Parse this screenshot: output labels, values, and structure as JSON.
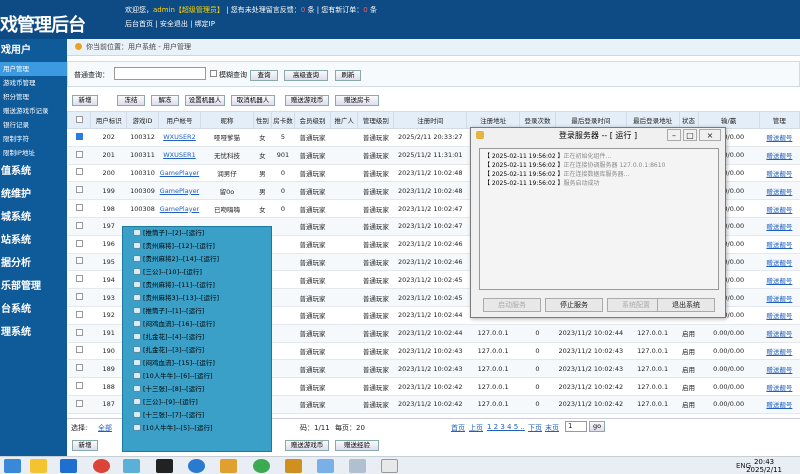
{
  "logo": "戏管理后台",
  "topbar": {
    "welcome": "欢迎您，",
    "admin": "admin【超级管理员】",
    "sep1": "|",
    "unread_label": "您有未处理留言反馈：",
    "unread_count": "0",
    "unit1": "条",
    "sep2": "|",
    "newmsg_label": "您有新订单：",
    "newmsg_count": "0",
    "unit2": "条",
    "links": [
      "后台首页",
      "|",
      "安全退出",
      "|",
      "绑定IP"
    ]
  },
  "sidebar": {
    "items": [
      {
        "text": "戏用户",
        "type": "head"
      },
      {
        "text": "用户管理",
        "type": "item",
        "active": true
      },
      {
        "text": "游戏币管理",
        "type": "item"
      },
      {
        "text": "积分管理",
        "type": "item"
      },
      {
        "text": "赠送游戏币记录",
        "type": "item"
      },
      {
        "text": "银行记录",
        "type": "item"
      },
      {
        "text": "限制字符",
        "type": "item"
      },
      {
        "text": "限制IP地址",
        "type": "item"
      },
      {
        "text": "值系统",
        "type": "head"
      },
      {
        "text": "统维护",
        "type": "head"
      },
      {
        "text": "城系统",
        "type": "head"
      },
      {
        "text": "站系统",
        "type": "head"
      },
      {
        "text": "据分析",
        "type": "head"
      },
      {
        "text": "乐部管理",
        "type": "head"
      },
      {
        "text": "台系统",
        "type": "head"
      },
      {
        "text": "理系统",
        "type": "head"
      }
    ]
  },
  "breadcrumb": "你当前位置：用户系统 - 用户管理",
  "query": {
    "label": "普通查询：",
    "value": "",
    "fuzzy": "模糊查询",
    "search": "查询",
    "advanced": "高级查询",
    "refresh": "刷新"
  },
  "actions": [
    "新增",
    "冻结",
    "解冻",
    "设置机器人",
    "取消机器人",
    "赠送游戏币",
    "赠送房卡"
  ],
  "table": {
    "headers": [
      "",
      "用户标识",
      "游戏ID",
      "用户帐号",
      "昵称",
      "性别",
      "房卡数",
      "会员级别",
      "推广人",
      "管理级别",
      "注册时间",
      "注册地址",
      "登录次数",
      "最后登录时间",
      "最后登录地址",
      "状态",
      "输/赢",
      "管理"
    ],
    "rows": [
      [
        "on",
        "202",
        "100312",
        "WXUSER2",
        "哑哑爹猫",
        "女",
        "5",
        "普通玩家",
        "",
        "普通玩家",
        "2025/2/11 20:33:27",
        "",
        "",
        "",
        "",
        "",
        "0.00/0.00",
        "赠送靓号"
      ],
      [
        "",
        "201",
        "100311",
        "WXUSER1",
        "无忧科技",
        "女",
        "901",
        "普通玩家",
        "",
        "普通玩家",
        "2025/11/2 11:31:01",
        "",
        "",
        "",
        "",
        "",
        "0.00/0.00",
        "赠送靓号"
      ],
      [
        "",
        "200",
        "100310",
        "GamePlayer",
        "润男仔",
        "男",
        "0",
        "普通玩家",
        "",
        "普通玩家",
        "2023/11/2 10:02:48",
        "",
        "",
        "",
        "",
        "",
        "0.00/0.00",
        "赠送靓号"
      ],
      [
        "",
        "199",
        "100309",
        "GamePlayer",
        "留0o",
        "男",
        "0",
        "普通玩家",
        "",
        "普通玩家",
        "2023/11/2 10:02:48",
        "",
        "",
        "",
        "",
        "",
        "0.00/0.00",
        "赠送靓号"
      ],
      [
        "",
        "198",
        "100308",
        "GamePlayer",
        "已吻嗨嗨",
        "女",
        "0",
        "普通玩家",
        "",
        "普通玩家",
        "2023/11/2 10:02:47",
        "",
        "",
        "",
        "",
        "",
        "0.00/0.00",
        "赠送靓号"
      ],
      [
        "",
        "197",
        "",
        "",
        "",
        "",
        "",
        "普通玩家",
        "",
        "普通玩家",
        "2023/11/2 10:02:47",
        "",
        "",
        "",
        "",
        "",
        "0.00/0.00",
        "赠送靓号"
      ],
      [
        "",
        "196",
        "",
        "",
        "",
        "",
        "",
        "普通玩家",
        "",
        "普通玩家",
        "2023/11/2 10:02:46",
        "",
        "",
        "",
        "",
        "",
        "0.00/0.00",
        "赠送靓号"
      ],
      [
        "",
        "195",
        "",
        "",
        "",
        "",
        "",
        "普通玩家",
        "",
        "普通玩家",
        "2023/11/2 10:02:46",
        "",
        "",
        "",
        "",
        "",
        "0.00/0.00",
        "赠送靓号"
      ],
      [
        "",
        "194",
        "",
        "",
        "",
        "",
        "",
        "普通玩家",
        "",
        "普通玩家",
        "2023/11/2 10:02:45",
        "",
        "",
        "",
        "",
        "",
        "0.00/0.00",
        "赠送靓号"
      ],
      [
        "",
        "193",
        "",
        "",
        "",
        "",
        "",
        "普通玩家",
        "",
        "普通玩家",
        "2023/11/2 10:02:45",
        "",
        "",
        "",
        "",
        "",
        "0.00/0.00",
        "赠送靓号"
      ],
      [
        "",
        "192",
        "",
        "",
        "",
        "",
        "",
        "普通玩家",
        "",
        "普通玩家",
        "2023/11/2 10:02:44",
        "",
        "",
        "",
        "",
        "",
        "0.00/0.00",
        "赠送靓号"
      ],
      [
        "",
        "191",
        "",
        "",
        "",
        "",
        "",
        "普通玩家",
        "",
        "普通玩家",
        "2023/11/2 10:02:44",
        "127.0.0.1",
        "0",
        "2023/11/2 10:02:44",
        "127.0.0.1",
        "启用",
        "0.00/0.00",
        "赠送靓号"
      ],
      [
        "",
        "190",
        "",
        "",
        "",
        "",
        "",
        "普通玩家",
        "",
        "普通玩家",
        "2023/11/2 10:02:43",
        "127.0.0.1",
        "0",
        "2023/11/2 10:02:43",
        "127.0.0.1",
        "启用",
        "0.00/0.00",
        "赠送靓号"
      ],
      [
        "",
        "189",
        "",
        "",
        "",
        "",
        "",
        "普通玩家",
        "",
        "普通玩家",
        "2023/11/2 10:02:43",
        "127.0.0.1",
        "0",
        "2023/11/2 10:02:43",
        "127.0.0.1",
        "启用",
        "0.00/0.00",
        "赠送靓号"
      ],
      [
        "",
        "188",
        "",
        "",
        "",
        "",
        "",
        "普通玩家",
        "",
        "普通玩家",
        "2023/11/2 10:02:42",
        "127.0.0.1",
        "0",
        "2023/11/2 10:02:42",
        "127.0.0.1",
        "启用",
        "0.00/0.00",
        "赠送靓号"
      ],
      [
        "",
        "187",
        "",
        "",
        "",
        "",
        "",
        "普通玩家",
        "",
        "普通玩家",
        "2023/11/2 10:02:42",
        "127.0.0.1",
        "0",
        "2023/11/2 10:02:42",
        "127.0.0.1",
        "启用",
        "0.00/0.00",
        "赠送靓号"
      ]
    ]
  },
  "footer": {
    "select": "选择:",
    "all": "全部",
    "pages": "码：1/11",
    "per_page": "每页：20",
    "first": "首页",
    "prev": "上页",
    "nums": "1 2 3 4 5 ..",
    "next": "下页",
    "last": "末页",
    "page_value": "1",
    "go": "go"
  },
  "bottom_actions": [
    "新增",
    "赠送游戏币",
    "赠送经验"
  ],
  "dialog": {
    "title": "登录服务器 -- [ 运行 ]",
    "logs": [
      {
        "ts": "【 2025-02-11 19:56:02 】",
        "msg": "正在初始化组件..."
      },
      {
        "ts": "【 2025-02-11 19:56:02 】",
        "msg": "正在连接协调服务器 127.0.0.1:8610"
      },
      {
        "ts": "【 2025-02-11 19:56:02 】",
        "msg": "正在连接数据库服务器..."
      },
      {
        "ts": "【 2025-02-11 19:56:02 】",
        "msg": "服务启动成功"
      }
    ],
    "buttons": [
      "启动服务",
      "停止服务",
      "系统配置",
      "退出系统"
    ]
  },
  "process_list": [
    "[推筒子]--[2]--[运行]",
    "[贵州麻将]--[12]--[运行]",
    "[贵州麻将2]--[14]--[运行]",
    "[三公]--[10]--[运行]",
    "[贵州麻将]--[11]--[运行]",
    "[贵州麻将3]--[13]--[运行]",
    "[推筒子]--[1]--[运行]",
    "[闷鸡血流]--[16]--[运行]",
    "[扎金花]--[4]--[运行]",
    "[扎金花]--[3]--[运行]",
    "[闷鸡血流]--[15]--[运行]",
    "[10人牛牛]--[6]--[运行]",
    "[十三张]--[8]--[运行]",
    "[三公]--[9]--[运行]",
    "[十三张]--[7]--[运行]",
    "[10人牛牛]--[5]--[运行]"
  ],
  "taskbar": {
    "lang": "ENG",
    "time": "20:43",
    "date": "2025/2/11"
  }
}
